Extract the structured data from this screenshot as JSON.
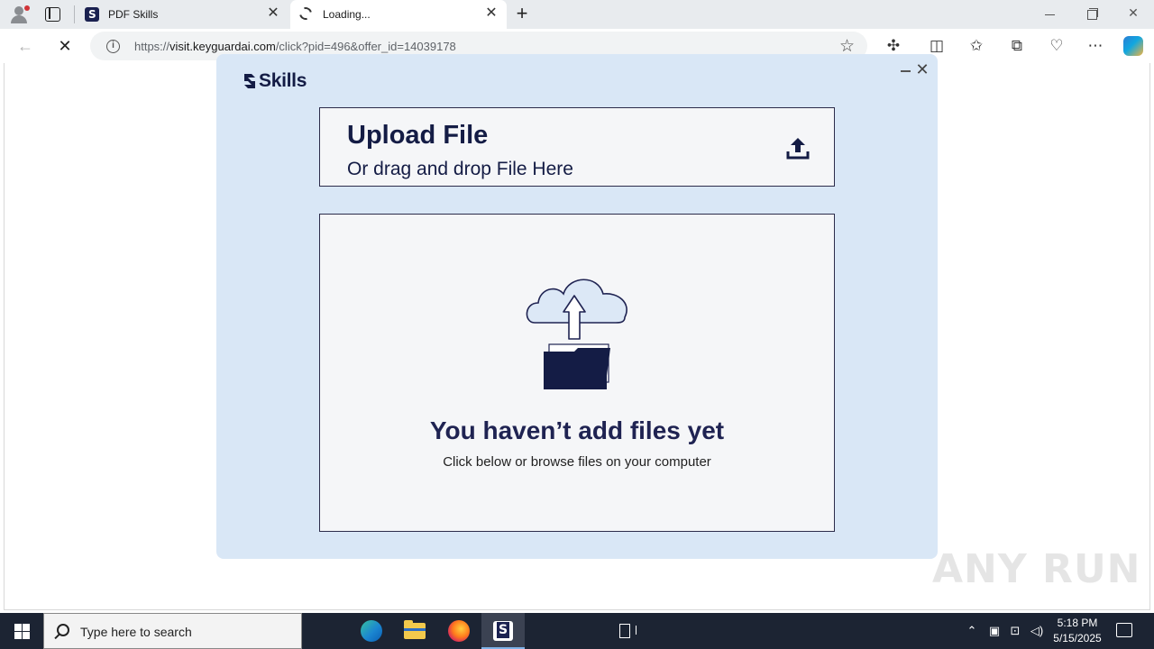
{
  "browser": {
    "tabs": [
      {
        "title": "PDF Skills",
        "favicon": "skills-favicon",
        "active": false
      },
      {
        "title": "Loading...",
        "favicon": "loading-spinner",
        "active": true
      }
    ],
    "address": {
      "url_prefix": "https://",
      "url_host": "visit.keyguardai.com",
      "url_path": "/click?pid=496&offer_id=14039178"
    }
  },
  "popup": {
    "brand": "Skills",
    "upload": {
      "title": "Upload File",
      "subtitle": "Or drag and drop File Here",
      "icon": "upload-icon"
    },
    "empty_state": {
      "title": "You haven’t add files yet",
      "subtitle": "Click below or browse files on your computer",
      "illustration": "cloud-upload-folder-illustration"
    }
  },
  "watermark": "ANY RUN",
  "taskbar": {
    "search_placeholder": "Type here to search",
    "apps": [
      "task-view",
      "edge",
      "file-explorer",
      "firefox",
      "skills"
    ],
    "clock": {
      "time": "5:18 PM",
      "date": "5/15/2025"
    }
  },
  "colors": {
    "popup_bg": "#d9e7f6",
    "brand_navy": "#141c45",
    "taskbar_bg": "#1c2433"
  }
}
